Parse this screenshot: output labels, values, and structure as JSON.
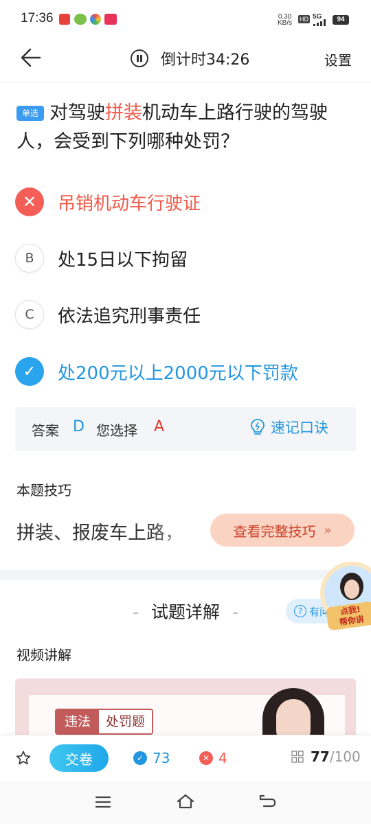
{
  "status_bar": {
    "time": "17:36",
    "network_speed_value": "0.30",
    "network_speed_unit": "KB/s",
    "hd": "HD",
    "signal": "5G",
    "battery": "94"
  },
  "header": {
    "timer": "倒计时34:26",
    "settings": "设置"
  },
  "question": {
    "type_tag": "单选",
    "text_before": "对驾驶",
    "text_highlight": "拼装",
    "text_after": "机动车上路行驶的驾驶人，会受到下列哪种处罚？"
  },
  "options": [
    {
      "marker": "✕",
      "label": "吊销机动车行驶证",
      "state": "wrong"
    },
    {
      "marker": "B",
      "label": "处15日以下拘留",
      "state": "normal"
    },
    {
      "marker": "C",
      "label": "依法追究刑事责任",
      "state": "normal"
    },
    {
      "marker": "✓",
      "label": "处200元以上2000元以下罚款",
      "state": "correct"
    }
  ],
  "answer_box": {
    "answer_label": "答案",
    "answer_value": "D",
    "chosen_label": "您选择",
    "chosen_value": "A",
    "quick_memo": "速记口诀"
  },
  "skill": {
    "title": "本题技巧",
    "text": "拼装、报废车上路，",
    "button": "查看完整技巧",
    "button_arrow": "»"
  },
  "detail": {
    "title": "试题详解",
    "dash": "-",
    "help_label": "有问",
    "help_icon": "?",
    "assistant_label_line1": "点我!",
    "assistant_label_line2": "帮你讲",
    "video_label": "视频讲解",
    "video_tag_left": "违法",
    "video_tag_right": "处罚题"
  },
  "bottom_bar": {
    "submit": "交卷",
    "correct_count": "73",
    "wrong_count": "4",
    "current": "77",
    "total": "/100"
  },
  "colors": {
    "accent_blue": "#2296e0",
    "wrong_red": "#f35e57",
    "tip_orange": "#fbd3c2"
  }
}
